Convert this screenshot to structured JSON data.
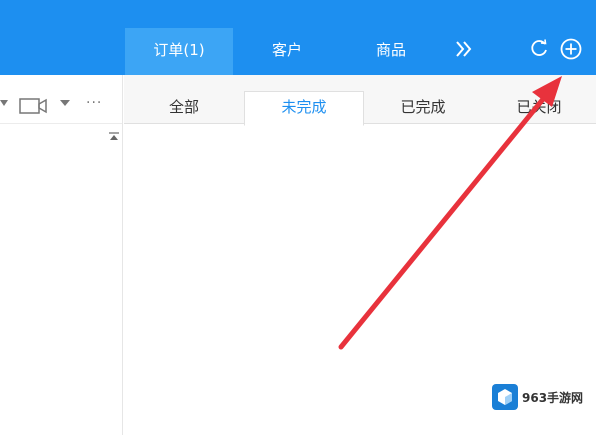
{
  "header": {
    "nav_tabs": [
      {
        "label": "订单(1)",
        "active": true
      },
      {
        "label": "客户",
        "active": false
      },
      {
        "label": "商品",
        "active": false
      }
    ],
    "more_icon": "double-chevron-right-icon",
    "refresh_icon": "refresh-icon",
    "add_icon": "add-circle-icon"
  },
  "left_toolbar": {
    "more_label": "···"
  },
  "subtabs": [
    {
      "label": "全部",
      "active": false
    },
    {
      "label": "未完成",
      "active": true
    },
    {
      "label": "已完成",
      "active": false
    },
    {
      "label": "已关闭",
      "active": false
    }
  ],
  "watermark": {
    "text": "963手游网"
  },
  "colors": {
    "topbar": "#1d8ff0",
    "active_tab": "#3ca5f5",
    "annotation_arrow": "#e8323c",
    "active_subtab_text": "#1d8ff0"
  }
}
